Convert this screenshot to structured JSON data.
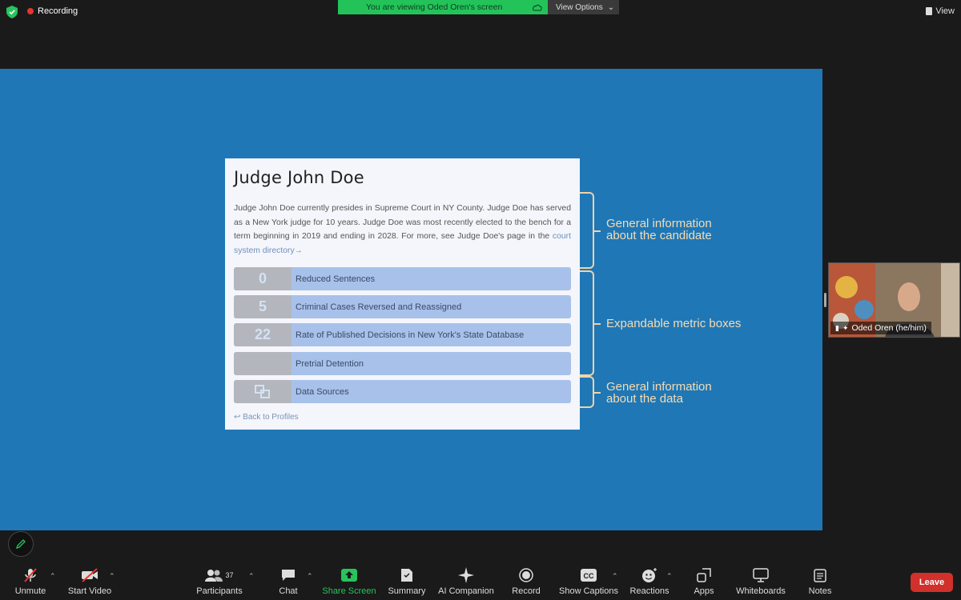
{
  "topbar": {
    "recording_label": "Recording",
    "viewing_label": "You are viewing Oded Oren's screen",
    "view_options_label": "View Options",
    "view_label": "View"
  },
  "slide": {
    "card_title": "Judge John Doe",
    "card_intro": "Judge John Doe currently presides in Supreme Court in NY County. Judge Doe has served as a New York judge for 10 years. Judge Doe was most recently elected to the bench for a term beginning in 2019 and ending in 2028. For more, see Judge Doe's page in the ",
    "card_link": "court system directory→",
    "metrics": [
      {
        "num": "0",
        "label": "Reduced Sentences"
      },
      {
        "num": "5",
        "label": "Criminal Cases Reversed and Reassigned"
      },
      {
        "num": "22",
        "label": "Rate of Published Decisions in New York's State Database"
      },
      {
        "num": "",
        "label": "Pretrial Detention"
      },
      {
        "num": "",
        "label": "Data Sources"
      }
    ],
    "back_link": "↩ Back to Profiles",
    "annotations": {
      "general_info": "General information about the candidate",
      "metric_boxes": "Expandable metric boxes",
      "data_info": "General information about the data"
    }
  },
  "participant": {
    "name": "Oded Oren (he/him)"
  },
  "toolbar": {
    "unmute": "Unmute",
    "start_video": "Start Video",
    "participants": "Participants",
    "participants_count": "37",
    "chat": "Chat",
    "share_screen": "Share Screen",
    "summary": "Summary",
    "ai_companion": "AI Companion",
    "record": "Record",
    "show_captions": "Show Captions",
    "reactions": "Reactions",
    "apps": "Apps",
    "whiteboards": "Whiteboards",
    "notes": "Notes",
    "leave": "Leave"
  },
  "colors": {
    "slide_bg": "#1f77b6",
    "share_green": "#27c45c",
    "leave_red": "#d1302b",
    "annotation": "#f6dcb2"
  }
}
